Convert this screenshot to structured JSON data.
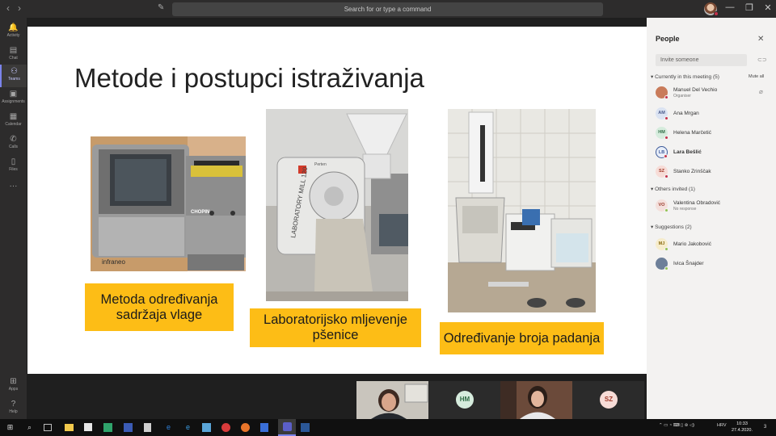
{
  "titlebar": {
    "search_placeholder": "Search for or type a command",
    "back_glyph": "‹",
    "forward_glyph": "›",
    "compose_glyph": "✎",
    "window_controls": [
      "—",
      "❐",
      "✕"
    ],
    "more_glyph": "···"
  },
  "rail": {
    "items": [
      {
        "label": "Activity",
        "icon": "bell-icon",
        "glyph": "🔔"
      },
      {
        "label": "Chat",
        "icon": "chat-icon",
        "glyph": "▤"
      },
      {
        "label": "Teams",
        "icon": "teams-icon",
        "glyph": "⚇"
      },
      {
        "label": "Assignments",
        "icon": "assignments-icon",
        "glyph": "▣"
      },
      {
        "label": "Calendar",
        "icon": "calendar-icon",
        "glyph": "▦"
      },
      {
        "label": "Calls",
        "icon": "phone-icon",
        "glyph": "✆"
      },
      {
        "label": "Files",
        "icon": "files-icon",
        "glyph": "▯"
      },
      {
        "label": "",
        "icon": "more-icon",
        "glyph": "···"
      },
      {
        "label": "Apps",
        "icon": "apps-icon",
        "glyph": "⊞"
      },
      {
        "label": "Help",
        "icon": "help-icon",
        "glyph": "?"
      }
    ]
  },
  "slide": {
    "title": "Metode i postupci istraživanja",
    "photos": {
      "photo1_brand": "infraneo",
      "photo1_logo": "CHOPIN",
      "photo2_text": "LABORATORY MILL 120",
      "photo2_brand": "Perten"
    },
    "callouts": [
      {
        "text": "Metoda određivanja sadržaja vlage"
      },
      {
        "text": "Laboratorijsko mljevenje pšenice"
      },
      {
        "text": "Određivanje broja padanja"
      }
    ]
  },
  "video_tiles": [
    {
      "type": "video",
      "name": "participant-video-1"
    },
    {
      "type": "initials",
      "initials": "HM"
    },
    {
      "type": "video",
      "name": "participant-video-2"
    },
    {
      "type": "initials",
      "initials": "SZ"
    }
  ],
  "people_panel": {
    "title": "People",
    "close_glyph": "✕",
    "invite_placeholder": "Invite someone",
    "link_glyph": "⊂⊃",
    "mute_all": "Mute all",
    "currently_header": "Currently in this meeting (5)",
    "others_header": "Others invited (1)",
    "suggestions_header": "Suggestions (2)",
    "currently": [
      {
        "name": "Manuel Del Vechio",
        "sub": "Organiser",
        "initials": "",
        "color": "#c97b5a",
        "status": "#c4314b",
        "bold": false
      },
      {
        "name": "Ana Mrgan",
        "sub": "",
        "initials": "AM",
        "color": "#dbe3f2",
        "fg": "#4a5a8a",
        "status": "#c4314b",
        "bold": false
      },
      {
        "name": "Helena Marčetić",
        "sub": "",
        "initials": "HM",
        "color": "#d6ecdd",
        "fg": "#2f6b45",
        "status": "#c4314b",
        "bold": false
      },
      {
        "name": "Lara Bešlić",
        "sub": "",
        "initials": "LB",
        "color": "#e8eef9",
        "fg": "#3d5a99",
        "status": "#c4314b",
        "bold": true
      },
      {
        "name": "Stanko Zrinščak",
        "sub": "",
        "initials": "SZ",
        "color": "#f7dcd7",
        "fg": "#a03a2a",
        "status": "#c4314b",
        "bold": false
      }
    ],
    "others": [
      {
        "name": "Valentina Obradović",
        "sub": "No response",
        "initials": "VO",
        "color": "#f4e0dc",
        "fg": "#9a3a2c",
        "status": "#92c353"
      }
    ],
    "suggestions": [
      {
        "name": "Mario Jakobović",
        "initials": "MJ",
        "color": "#f6eccc",
        "fg": "#8a6a10",
        "status": "#92c353"
      },
      {
        "name": "Ivica Šnajder",
        "initials": "",
        "color": "#6d7f99",
        "status": "#92c353"
      }
    ]
  },
  "taskbar": {
    "start_glyph": "⊞",
    "search_glyph": "⌕",
    "lang": "HRV",
    "time": "10:33",
    "date": "27.4.2020.",
    "notif_count": "3",
    "tray_glyphs": "⌃ ▭ ◔ ⌨ ▯ ⊛ ◁)"
  },
  "colors": {
    "callout": "#fdbd16",
    "accent": "#7b83eb",
    "busy": "#c4314b",
    "available": "#92c353"
  }
}
